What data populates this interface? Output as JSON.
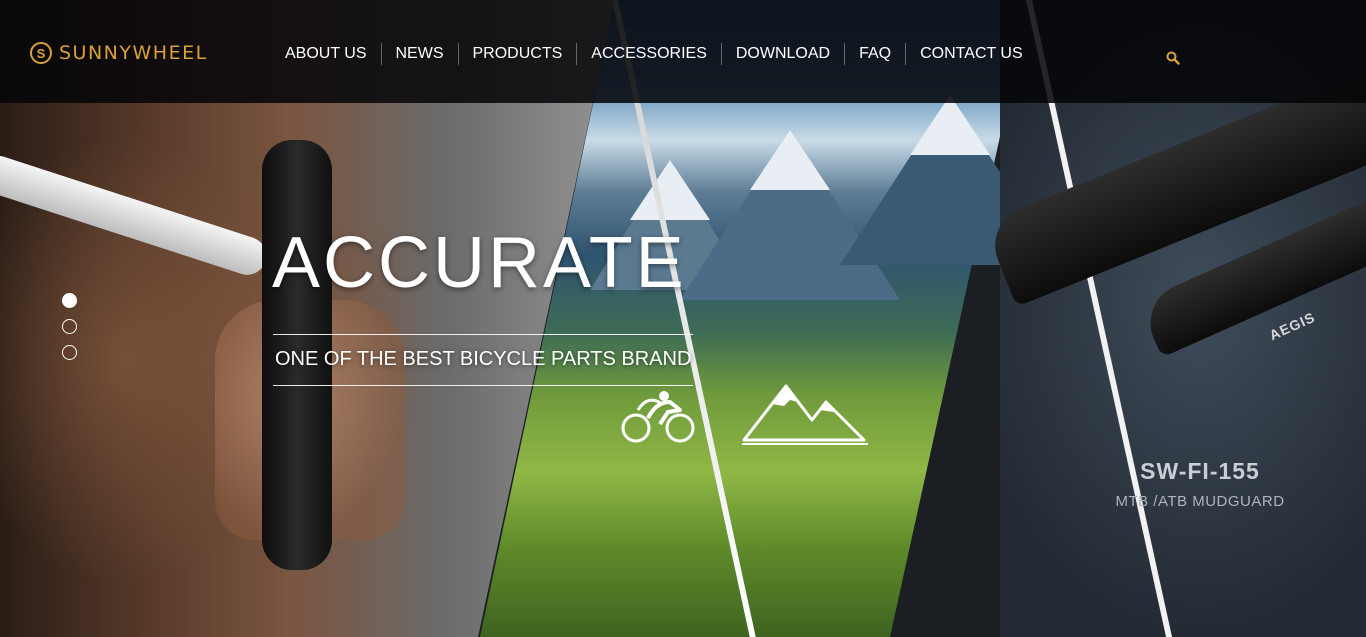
{
  "header": {
    "logo_mark": "S",
    "logo_text": "SUNNYWHEEL",
    "nav": [
      {
        "label": "ABOUT US"
      },
      {
        "label": "NEWS"
      },
      {
        "label": "PRODUCTS"
      },
      {
        "label": "ACCESSORIES"
      },
      {
        "label": "DOWNLOAD"
      },
      {
        "label": "FAQ"
      },
      {
        "label": "CONTACT US"
      }
    ],
    "search_icon": "search-icon"
  },
  "hero": {
    "headline": "ACCURATE",
    "tagline": "ONE OF THE BEST BICYCLE PARTS BRAND",
    "icons": [
      "cyclist-icon",
      "mountains-icon"
    ],
    "product": {
      "name": "SW-FI-155",
      "subtitle": "MTB /ATB MUDGUARD",
      "brand_on_product": "AEGIS"
    }
  },
  "pager": {
    "count": 3,
    "active_index": 0
  },
  "colors": {
    "brand_gold": "#d9a13a",
    "header_bg": "#050508",
    "text_white": "#ffffff"
  }
}
